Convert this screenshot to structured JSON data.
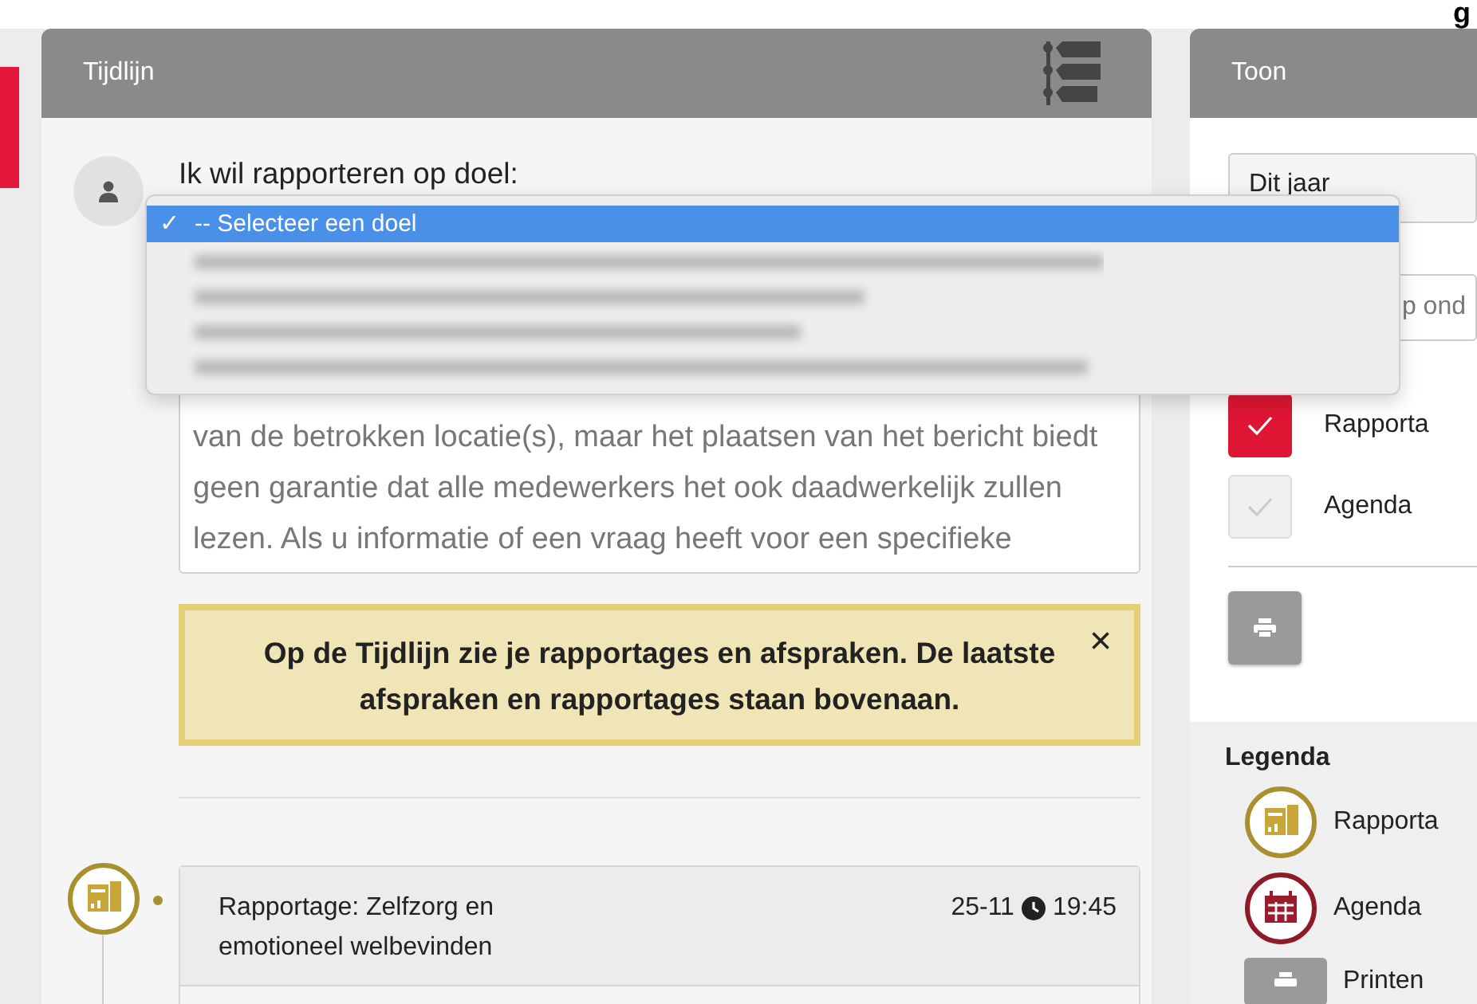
{
  "corner_text": "g",
  "timeline": {
    "title": "Tijdlijn",
    "goal_label": "Ik wil rapporteren op doel:",
    "goal_dropdown": {
      "options": [
        {
          "check": "✓",
          "text": "-- Selecteer een doel",
          "selected": true
        }
      ]
    },
    "message_text": "van de betrokken locatie(s), maar het plaatsen van het bericht biedt geen garantie dat alle medewerkers het ook daadwerkelijk zullen lezen. Als u informatie of een vraag heeft voor een specifieke",
    "alert": {
      "text": "Op de Tijdlijn zie je rapportages en afspraken. De laatste afspraken en rapportages staan bovenaan.",
      "close": "×"
    },
    "items": [
      {
        "kind": "report",
        "title": "Rapportage: Zelfzorg en emotioneel welbevinden",
        "date": "25-11",
        "time": "19:45"
      }
    ]
  },
  "toon": {
    "title": "Toon",
    "period": "Dit jaar",
    "search_visible": "p ond",
    "filters": [
      {
        "label": "Rapporta",
        "checked": true
      },
      {
        "label": "Agenda",
        "checked": false
      }
    ],
    "legend_title": "Legenda",
    "legend": [
      {
        "kind": "report",
        "label": "Rapporta"
      },
      {
        "kind": "agenda",
        "label": "Agenda"
      },
      {
        "kind": "print",
        "label": "Printen"
      }
    ]
  }
}
